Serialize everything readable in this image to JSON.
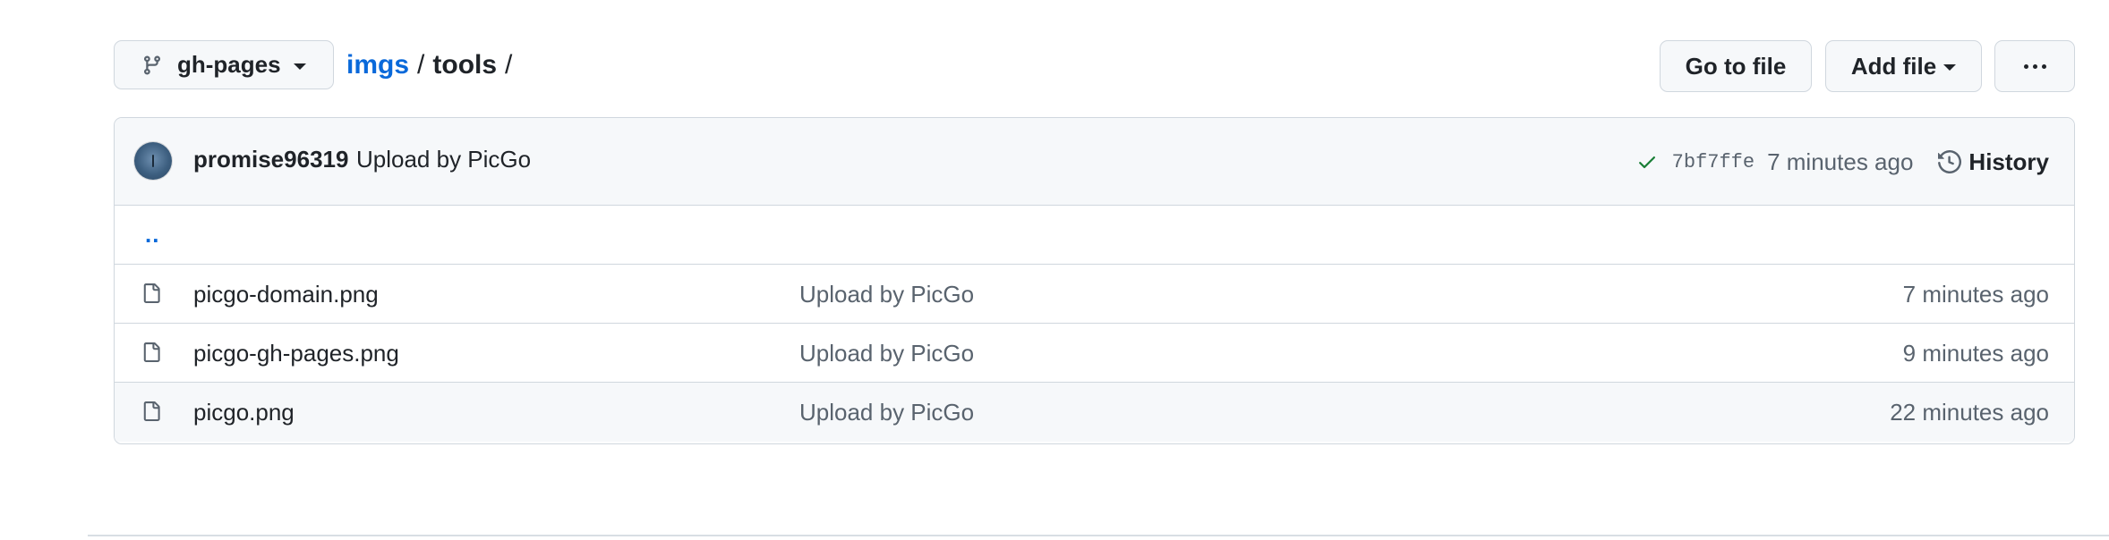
{
  "branch": {
    "name": "gh-pages",
    "icon": "git-branch-icon"
  },
  "breadcrumb": {
    "parent": "imgs",
    "separator": "/",
    "current": "tools",
    "trailing_separator": "/"
  },
  "actions": {
    "goto_file": "Go to file",
    "add_file": "Add file",
    "more_icon": "kebab-horizontal-icon"
  },
  "commit": {
    "author": "promise96319",
    "message": "Upload by PicGo",
    "status_icon": "check-icon",
    "status_color": "#1a7f37",
    "sha": "7bf7ffe",
    "time": "7 minutes ago",
    "history_label": "History",
    "history_icon": "history-icon"
  },
  "parent_dir": "..",
  "files": [
    {
      "name": "picgo-domain.png",
      "message": "Upload by PicGo",
      "time": "7 minutes ago",
      "icon": "file-icon"
    },
    {
      "name": "picgo-gh-pages.png",
      "message": "Upload by PicGo",
      "time": "9 minutes ago",
      "icon": "file-icon"
    },
    {
      "name": "picgo.png",
      "message": "Upload by PicGo",
      "time": "22 minutes ago",
      "icon": "file-icon"
    }
  ],
  "colors": {
    "link": "#0969da",
    "border": "#d0d7de",
    "muted": "#59636e",
    "header_bg": "#f6f8fa"
  }
}
